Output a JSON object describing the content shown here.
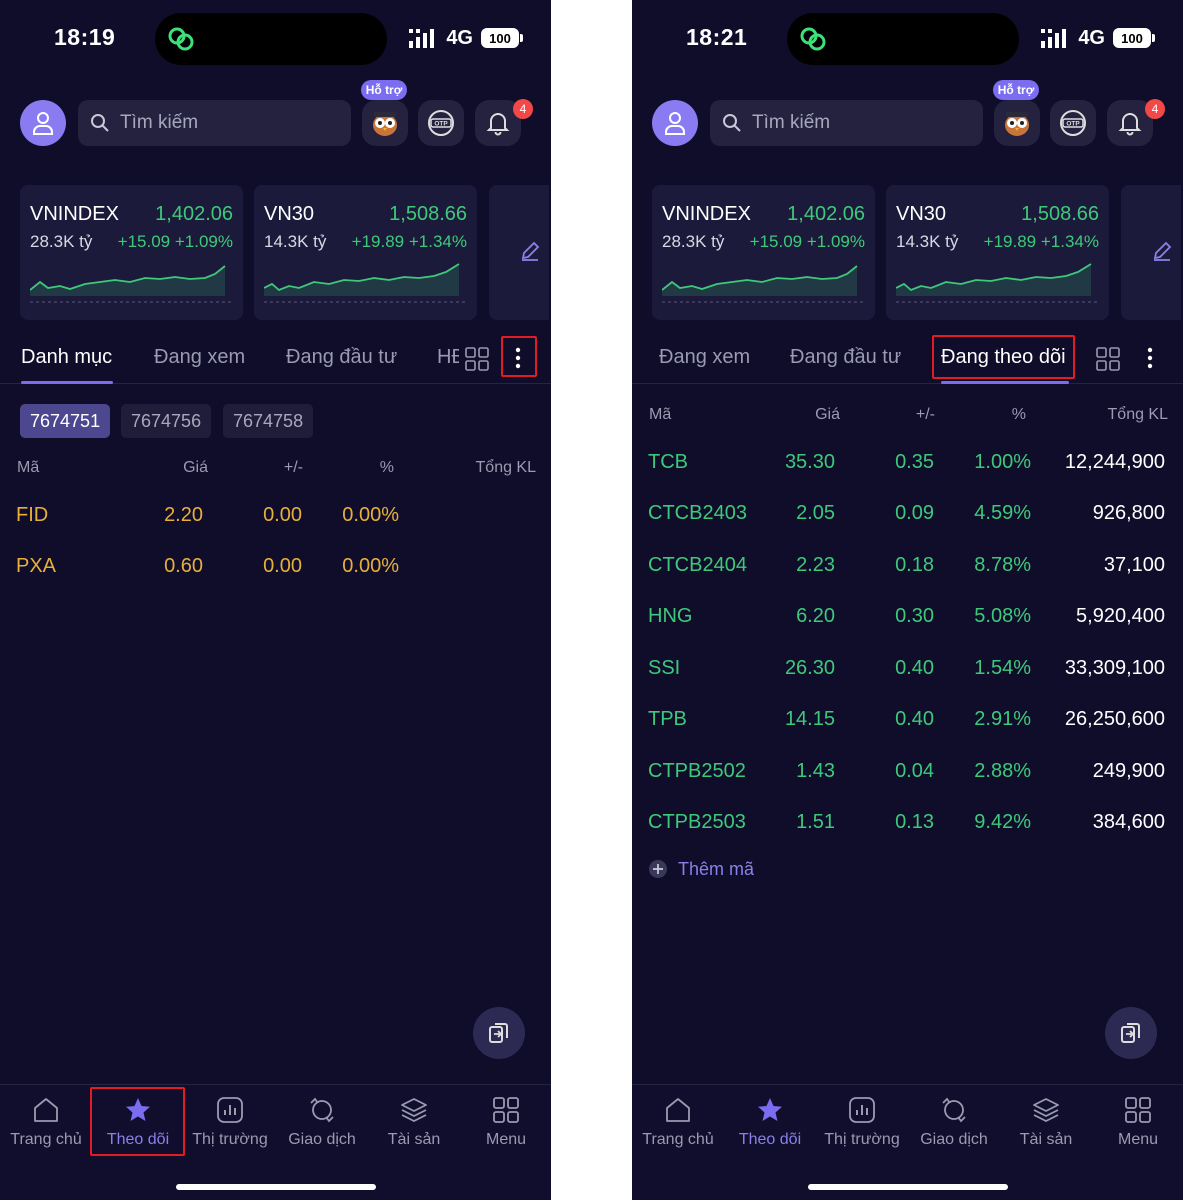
{
  "screens": [
    {
      "status": {
        "time": "18:19",
        "network": "4G",
        "battery": "100"
      },
      "search": {
        "placeholder": "Tìm kiếm"
      },
      "support_badge": "Hỗ trợ",
      "notification_count": "4",
      "indices": [
        {
          "name": "VNINDEX",
          "value": "1,402.06",
          "volume": "28.3K tỷ",
          "change": "+15.09 +1.09%"
        },
        {
          "name": "VN30",
          "value": "1,508.66",
          "volume": "14.3K tỷ",
          "change": "+19.89 +1.34%"
        }
      ],
      "tabs": [
        "Danh mục",
        "Đang xem",
        "Đang đầu tư",
        "HĐ"
      ],
      "active_tab": "Danh mục",
      "portfolio_chips": [
        "7674751",
        "7674756",
        "7674758"
      ],
      "active_chip": "7674751",
      "table": {
        "headers": {
          "symbol": "Mã",
          "price": "Giá",
          "change": "+/-",
          "percent": "%",
          "volume": "Tổng KL"
        },
        "rows": [
          {
            "symbol": "FID",
            "price": "2.20",
            "change": "0.00",
            "percent": "0.00%",
            "volume": ""
          },
          {
            "symbol": "PXA",
            "price": "0.60",
            "change": "0.00",
            "percent": "0.00%",
            "volume": ""
          }
        ]
      },
      "nav": [
        {
          "label": "Trang chủ",
          "icon": "home-icon"
        },
        {
          "label": "Theo dõi",
          "icon": "star-icon",
          "active": true
        },
        {
          "label": "Thị trường",
          "icon": "market-chart-icon"
        },
        {
          "label": "Giao dịch",
          "icon": "trade-exchange-icon"
        },
        {
          "label": "Tài sản",
          "icon": "assets-layers-icon"
        },
        {
          "label": "Menu",
          "icon": "menu-grid-icon"
        }
      ]
    },
    {
      "status": {
        "time": "18:21",
        "network": "4G",
        "battery": "100"
      },
      "search": {
        "placeholder": "Tìm kiếm"
      },
      "support_badge": "Hỗ trợ",
      "notification_count": "4",
      "indices": [
        {
          "name": "VNINDEX",
          "value": "1,402.06",
          "volume": "28.3K tỷ",
          "change": "+15.09 +1.09%"
        },
        {
          "name": "VN30",
          "value": "1,508.66",
          "volume": "14.3K tỷ",
          "change": "+19.89 +1.34%"
        }
      ],
      "tabs": [
        "Đang xem",
        "Đang đầu tư",
        "Đang theo dõi"
      ],
      "active_tab": "Đang theo dõi",
      "table": {
        "headers": {
          "symbol": "Mã",
          "price": "Giá",
          "change": "+/-",
          "percent": "%",
          "volume": "Tổng KL"
        },
        "rows": [
          {
            "symbol": "TCB",
            "price": "35.30",
            "change": "0.35",
            "percent": "1.00%",
            "volume": "12,244,900"
          },
          {
            "symbol": "CTCB2403",
            "price": "2.05",
            "change": "0.09",
            "percent": "4.59%",
            "volume": "926,800"
          },
          {
            "symbol": "CTCB2404",
            "price": "2.23",
            "change": "0.18",
            "percent": "8.78%",
            "volume": "37,100"
          },
          {
            "symbol": "HNG",
            "price": "6.20",
            "change": "0.30",
            "percent": "5.08%",
            "volume": "5,920,400"
          },
          {
            "symbol": "SSI",
            "price": "26.30",
            "change": "0.40",
            "percent": "1.54%",
            "volume": "33,309,100"
          },
          {
            "symbol": "TPB",
            "price": "14.15",
            "change": "0.40",
            "percent": "2.91%",
            "volume": "26,250,600"
          },
          {
            "symbol": "CTPB2502",
            "price": "1.43",
            "change": "0.04",
            "percent": "2.88%",
            "volume": "249,900"
          },
          {
            "symbol": "CTPB2503",
            "price": "1.51",
            "change": "0.13",
            "percent": "9.42%",
            "volume": "384,600"
          }
        ]
      },
      "add_symbol_label": "Thêm mã",
      "nav": [
        {
          "label": "Trang chủ",
          "icon": "home-icon"
        },
        {
          "label": "Theo dõi",
          "icon": "star-icon",
          "active": true
        },
        {
          "label": "Thị trường",
          "icon": "market-chart-icon"
        },
        {
          "label": "Giao dịch",
          "icon": "trade-exchange-icon"
        },
        {
          "label": "Tài sản",
          "icon": "assets-layers-icon"
        },
        {
          "label": "Menu",
          "icon": "menu-grid-icon"
        }
      ]
    }
  ],
  "colors": {
    "background": "#0f0d2a",
    "card": "#1c1a3a",
    "accent": "#7b6cf0",
    "up_green": "#3ec97a",
    "reference_yellow": "#e8b03a",
    "highlight_red": "#e31b23",
    "badge_red": "#f24848"
  }
}
